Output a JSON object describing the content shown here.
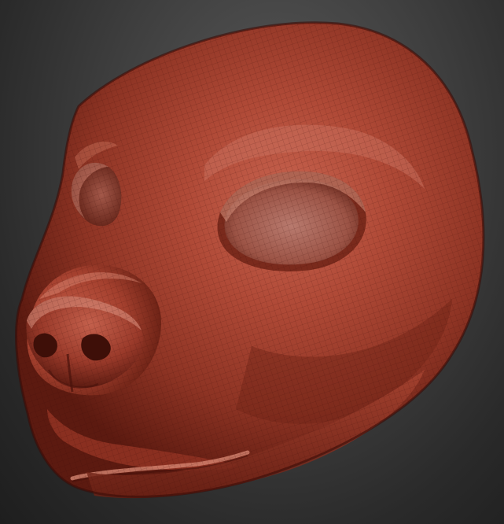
{
  "scene": {
    "subject": "sculpted-animal-head",
    "material_color": "#a8402e",
    "highlight_color": "#d98a76",
    "shadow_color": "#4a130c",
    "background_top": "#5a5a5a",
    "background_bottom": "#1e1e1e",
    "icons": [
      "mesh-wireframe-icon"
    ]
  }
}
